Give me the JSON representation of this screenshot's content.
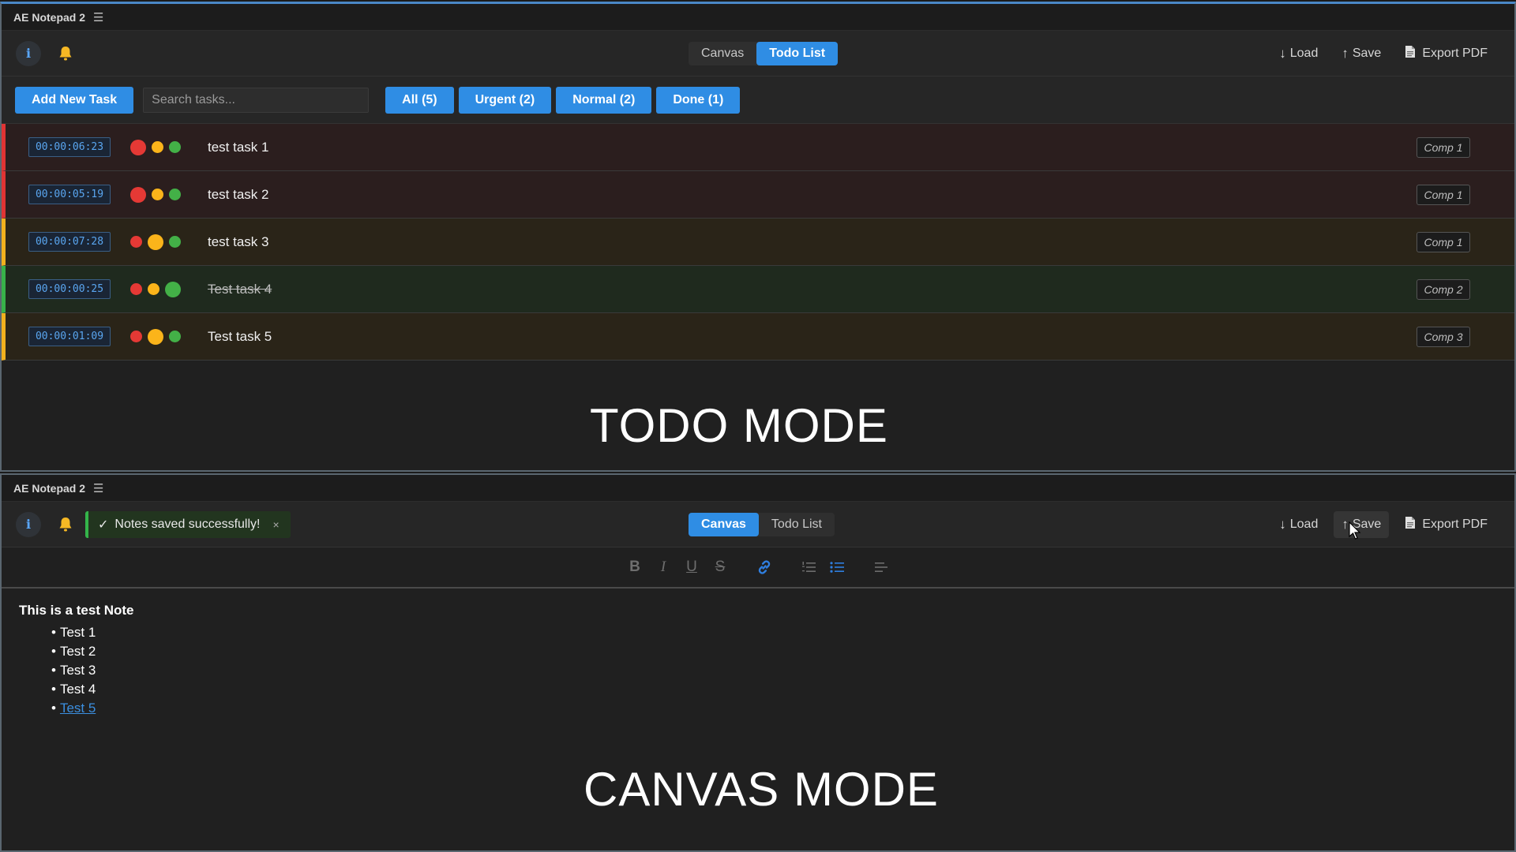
{
  "todo_panel": {
    "window_title": "AE Notepad 2",
    "menu_glyph": "☰",
    "info_label": "i",
    "mode_tabs": [
      {
        "label": "Canvas",
        "active": false
      },
      {
        "label": "Todo List",
        "active": true
      }
    ],
    "actions": {
      "load": {
        "glyph": "↓",
        "label": "Load"
      },
      "save": {
        "glyph": "↑",
        "label": "Save"
      },
      "export": {
        "label": "Export PDF"
      }
    },
    "add_task_label": "Add New Task",
    "search_placeholder": "Search tasks...",
    "filters": [
      "All (5)",
      "Urgent (2)",
      "Normal (2)",
      "Done (1)"
    ],
    "tasks": [
      {
        "timer": "00:00:06:23",
        "title": "test task 1",
        "comp": "Comp 1",
        "priority": "urgent",
        "done": false
      },
      {
        "timer": "00:00:05:19",
        "title": "test task 2",
        "comp": "Comp 1",
        "priority": "urgent",
        "done": false
      },
      {
        "timer": "00:00:07:28",
        "title": "test task 3",
        "comp": "Comp 1",
        "priority": "normal",
        "done": false
      },
      {
        "timer": "00:00:00:25",
        "title": "Test task 4",
        "comp": "Comp 2",
        "priority": "done",
        "done": true
      },
      {
        "timer": "00:00:01:09",
        "title": "Test task 5",
        "comp": "Comp 3",
        "priority": "normal",
        "done": false
      }
    ],
    "overlay_label": "TODO MODE"
  },
  "canvas_panel": {
    "window_title": "AE Notepad 2",
    "menu_glyph": "☰",
    "info_label": "i",
    "toast": {
      "check": "✓",
      "message": "Notes saved successfully!",
      "close": "×"
    },
    "mode_tabs": [
      {
        "label": "Canvas",
        "active": true
      },
      {
        "label": "Todo List",
        "active": false
      }
    ],
    "actions": {
      "load": {
        "glyph": "↓",
        "label": "Load"
      },
      "save": {
        "glyph": "↑",
        "label": "Save"
      },
      "export": {
        "label": "Export PDF"
      }
    },
    "format_tools": {
      "bold": "B",
      "italic": "I",
      "underline": "U",
      "strike": "S"
    },
    "note": {
      "heading": "This is a test Note",
      "bullet": "•",
      "items": [
        "Test 1",
        "Test 2",
        "Test 3",
        "Test 4"
      ],
      "link_item": "Test 5"
    },
    "overlay_label": "CANVAS MODE"
  },
  "colors": {
    "accent": "#2f8de4",
    "urgent": "#e03434",
    "normal": "#f0b01e",
    "done": "#38b04a"
  }
}
